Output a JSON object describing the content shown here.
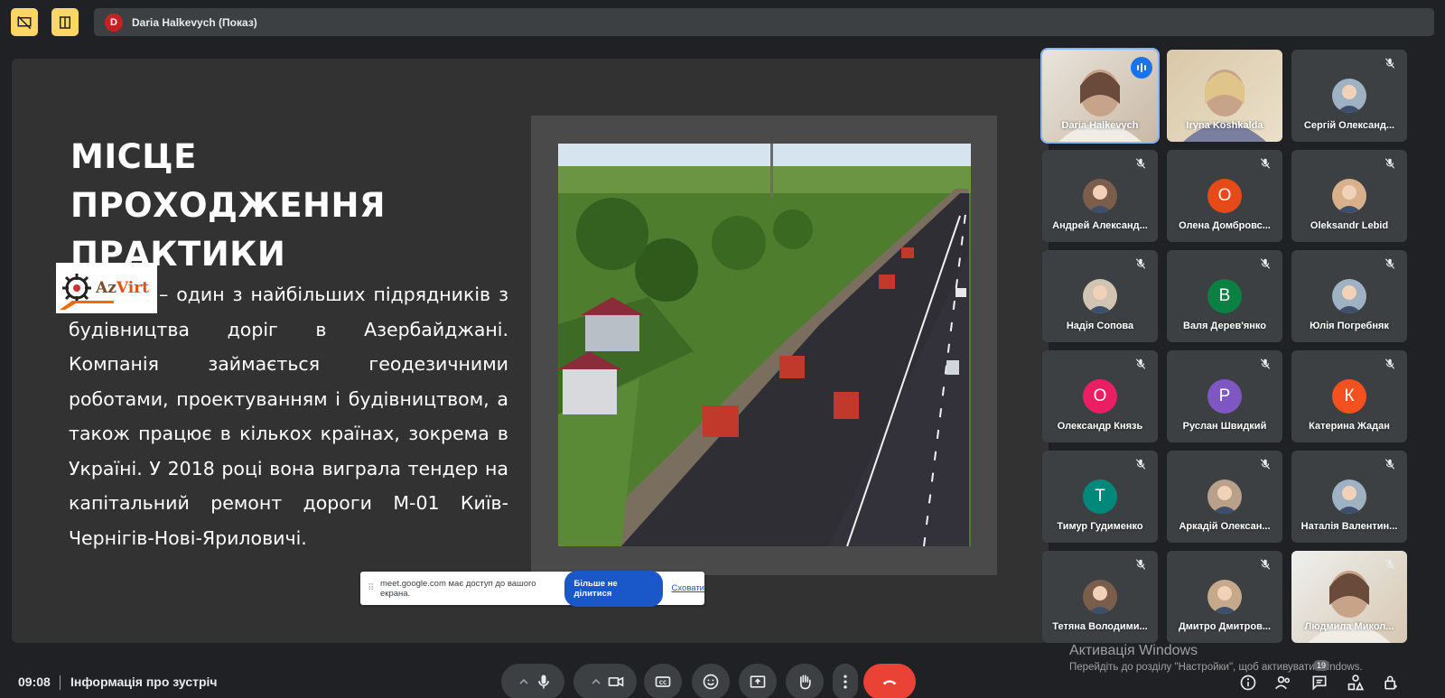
{
  "top_bar": {
    "presenter_initial": "D",
    "presenter_label": "Daria Halkevych (Показ)"
  },
  "slide": {
    "title": "МІСЦЕ ПРОХОДЖЕННЯ ПРАКТИКИ",
    "logo_text_a": "Az",
    "logo_text_b": "Virt",
    "body": "– один з найбільших підрядників з будівництва доріг в Азербайджані. Компанія займається геодезичними роботами, проектуванням і будівництвом, а також працює в кількох країнах, зокрема в Україні. У 2018 році вона виграла тендер на капітальний ремонт дороги М-01 Київ-Чернігів-Нові-Яриловичі."
  },
  "share_bar": {
    "message": "meet.google.com має доступ до вашого екрана.",
    "stop_label": "Більше не ділитися",
    "hide_label": "Сховати"
  },
  "participants": [
    {
      "name": "Daria Halkevych",
      "speaking": true
    },
    {
      "name": "Iryna Koshkalda"
    },
    {
      "name": "Сергій Олександ..."
    },
    {
      "name": "Андрей Александ..."
    },
    {
      "name": "Олена Домбровс...",
      "initial": "О",
      "color": "#e64a19"
    },
    {
      "name": "Oleksandr Lebid"
    },
    {
      "name": "Надія Сопова"
    },
    {
      "name": "Валя Дерев'янко",
      "initial": "В",
      "color": "#0b8043"
    },
    {
      "name": "Юлія Погребняк"
    },
    {
      "name": "Олександр Князь",
      "initial": "О",
      "color": "#e91e63"
    },
    {
      "name": "Руслан Швидкий",
      "initial": "Р",
      "color": "#7e57c2"
    },
    {
      "name": "Катерина Жадан",
      "initial": "К",
      "color": "#f4511e"
    },
    {
      "name": "Тимур Гудименко",
      "initial": "Т",
      "color": "#00897b"
    },
    {
      "name": "Аркадій Олексан..."
    },
    {
      "name": "Наталія Валентин..."
    },
    {
      "name": "Тетяна Володими..."
    },
    {
      "name": "Дмитро Дмитров..."
    },
    {
      "name": "Людмила Микол..."
    }
  ],
  "watermark": {
    "line1": "Активація Windows",
    "line2": "Перейдіть до розділу \"Настройки\", щоб активувати Windows."
  },
  "bottom_bar": {
    "time": "09:08",
    "meeting_info": "Інформація про зустріч",
    "participants_count": "19"
  }
}
